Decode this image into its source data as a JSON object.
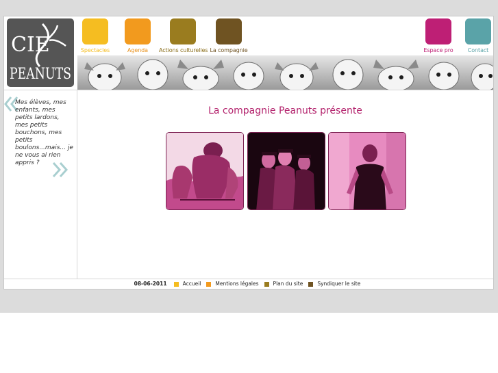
{
  "logo": {
    "line1": "CIE",
    "line2": "PEANUTS",
    "alt_icon": "antelope-head-icon"
  },
  "nav": [
    {
      "label": "Spectacles",
      "color": "#f5bd21",
      "text_color": "#f5bd21"
    },
    {
      "label": "Agenda",
      "color": "#f29a1e",
      "text_color": "#e8901a"
    },
    {
      "label": "Actions culturelles",
      "color": "#9a7c1f",
      "text_color": "#8a6e1a"
    },
    {
      "label": "La compagnie",
      "color": "#6f5322",
      "text_color": "#6f5322"
    }
  ],
  "nav_right": [
    {
      "label": "Espace pro",
      "color": "#be1f75",
      "text_color": "#be1f75"
    },
    {
      "label": "Contact",
      "color": "#5aa3a8",
      "text_color": "#5aa3a8"
    }
  ],
  "sidebar": {
    "quote": "Mes élèves, mes enfants, mes petits lardons, mes petits bouchons, mes petits boulons...mais... je ne vous ai rien appris ?",
    "quote_open_icon": "double-chevron-left-icon",
    "quote_close_icon": "double-chevron-right-icon"
  },
  "main": {
    "title": "La compagnie Peanuts présente",
    "photos": [
      "illustration-photo",
      "stage-photo",
      "actress-photo"
    ]
  },
  "footer": {
    "date": "08-06-2011",
    "links": [
      {
        "label": "Accueil",
        "color": "#f5bd21"
      },
      {
        "label": "Mentions légales",
        "color": "#f29a1e"
      },
      {
        "label": "Plan du site",
        "color": "#9a7c1f"
      },
      {
        "label": "Syndiquer le site",
        "color": "#6f5322"
      }
    ]
  }
}
